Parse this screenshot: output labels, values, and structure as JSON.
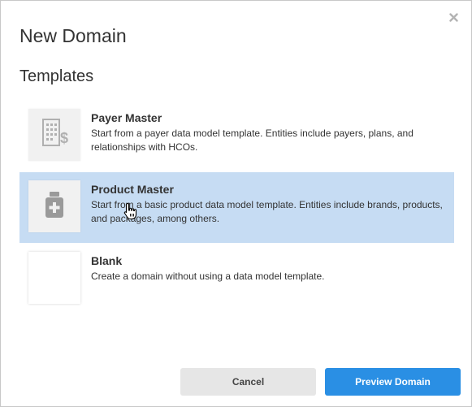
{
  "dialog": {
    "title": "New Domain",
    "close_icon": "close-icon",
    "section_title": "Templates"
  },
  "templates": [
    {
      "name": "Payer Master",
      "description": "Start from a payer data model template. Entities include payers, plans, and relationships with HCOs.",
      "icon": "building-dollar-icon",
      "selected": false
    },
    {
      "name": "Product Master",
      "description": "Start from a basic product data model template. Entities include brands, products, and packages, among others.",
      "icon": "medicine-bottle-icon",
      "selected": true
    },
    {
      "name": "Blank",
      "description": "Create a domain without using a data model template.",
      "icon": "blank-icon",
      "selected": false
    }
  ],
  "buttons": {
    "cancel_label": "Cancel",
    "preview_label": "Preview Domain"
  },
  "colors": {
    "selected_background": "#c6dcf3",
    "primary_button": "#2a8fe4",
    "secondary_button": "#e6e6e6",
    "text": "#333333"
  }
}
